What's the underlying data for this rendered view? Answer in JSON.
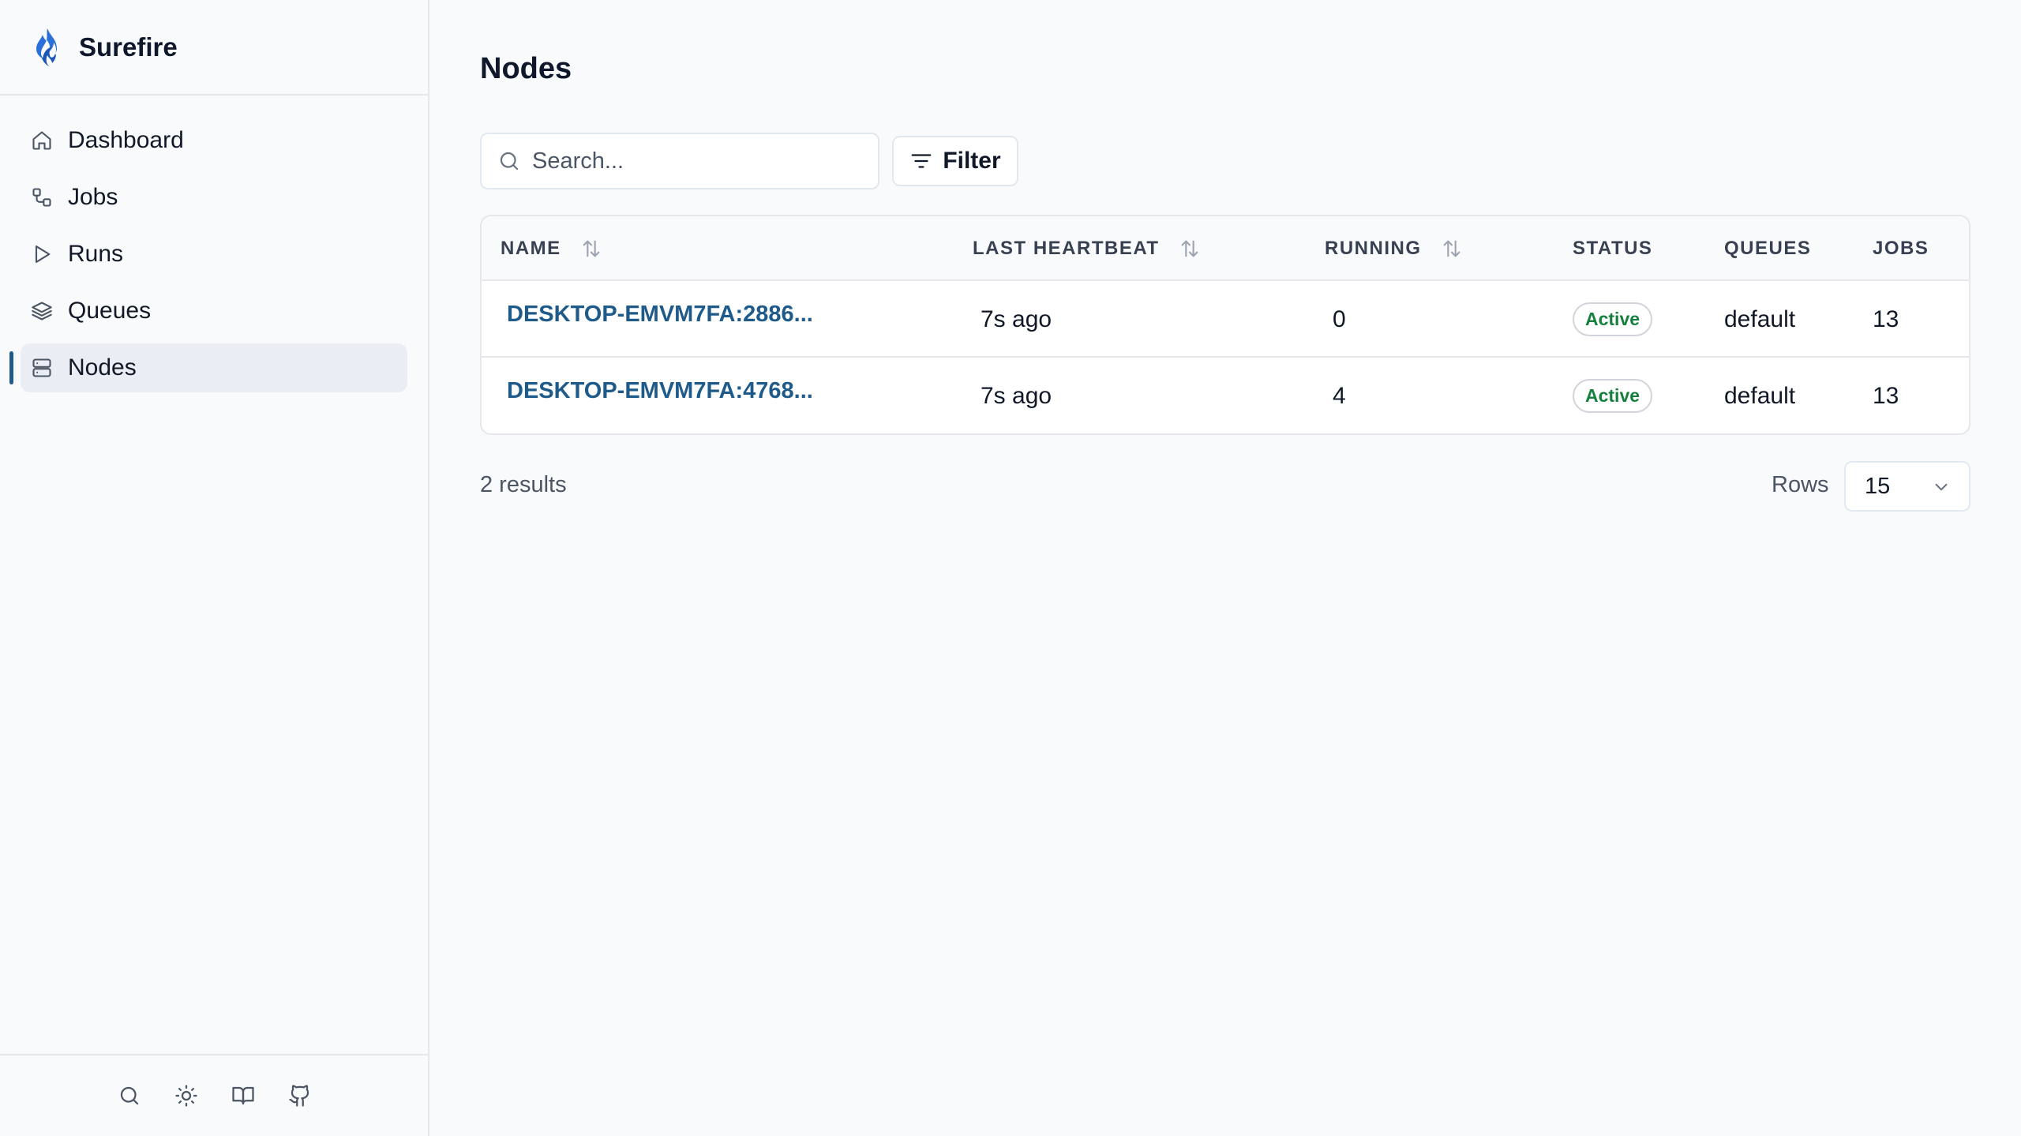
{
  "app": {
    "name": "Surefire",
    "accent": "#1e5a8a",
    "logo_color": "#2b6fd8"
  },
  "sidebar": {
    "items": [
      {
        "label": "Dashboard",
        "icon": "home-icon"
      },
      {
        "label": "Jobs",
        "icon": "jobs-icon"
      },
      {
        "label": "Runs",
        "icon": "play-icon"
      },
      {
        "label": "Queues",
        "icon": "layers-icon"
      },
      {
        "label": "Nodes",
        "icon": "server-icon",
        "active": true
      }
    ],
    "footer_icons": [
      "search-icon",
      "sun-icon",
      "book-icon",
      "github-icon"
    ]
  },
  "page": {
    "title": "Nodes"
  },
  "search": {
    "placeholder": "Search..."
  },
  "filter": {
    "label": "Filter"
  },
  "table": {
    "columns": {
      "name": "NAME",
      "last_heartbeat": "LAST HEARTBEAT",
      "running": "RUNNING",
      "status": "STATUS",
      "queues": "QUEUES",
      "jobs": "JOBS"
    },
    "rows": [
      {
        "name": "DESKTOP-EMVM7FA:2886...",
        "last_heartbeat": "7s ago",
        "running": "0",
        "status": "Active",
        "queues": "default",
        "jobs": "13"
      },
      {
        "name": "DESKTOP-EMVM7FA:4768...",
        "last_heartbeat": "7s ago",
        "running": "4",
        "status": "Active",
        "queues": "default",
        "jobs": "13"
      }
    ]
  },
  "footer": {
    "results": "2 results",
    "rows_label": "Rows",
    "rows_value": "15"
  }
}
